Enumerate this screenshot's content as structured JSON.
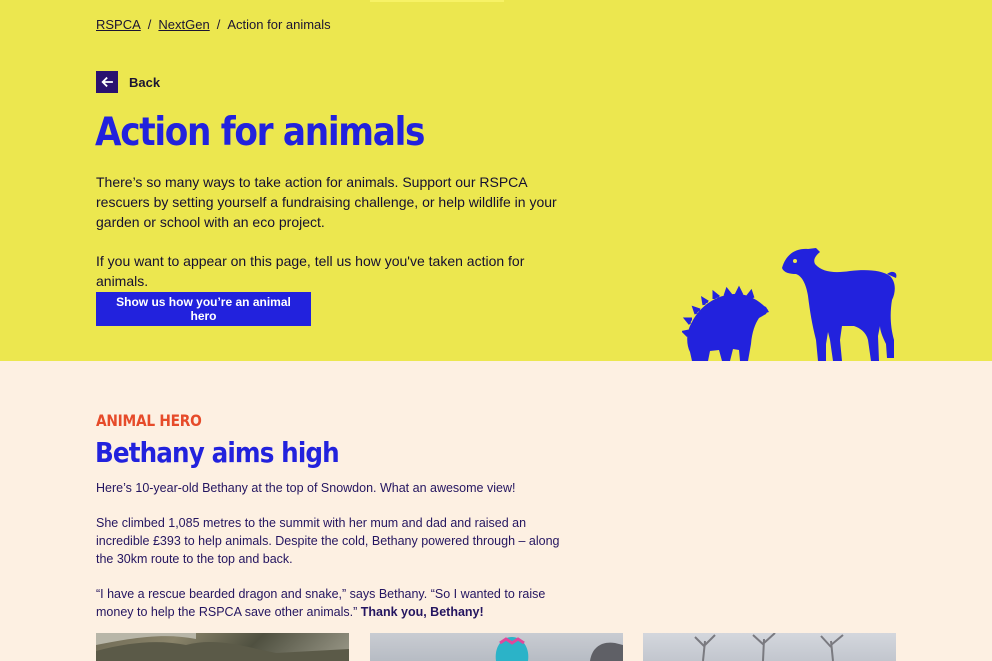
{
  "breadcrumb": {
    "items": [
      "RSPCA",
      "NextGen",
      "Action for animals"
    ],
    "separator": "/"
  },
  "back": {
    "label": "Back",
    "icon": "arrow-left-icon"
  },
  "hero": {
    "title": "Action for animals",
    "paragraph1": "There’s so many ways to take action for animals. Support our RSPCA rescuers by setting yourself a fundraising challenge, or help wildlife in your garden or school with an eco project.",
    "paragraph2": "If you want to appear on this page, tell us how you've taken action for animals.",
    "cta_label": "Show us how you’re an animal hero",
    "illustration": [
      "hedgehog-icon",
      "sheep-icon"
    ]
  },
  "story": {
    "label": "ANIMAL HERO",
    "title": "Bethany aims high",
    "paragraph1": "Here’s 10-year-old Bethany at the top of Snowdon. What an awesome view!",
    "paragraph2": "She climbed 1,085 metres to the summit with her mum and dad and raised an incredible £393 to help animals. Despite the cold, Bethany powered through – along the 30km route to the top and back.",
    "paragraph3_plain": "“I have a rescue bearded dragon and snake,” says Bethany. “So I wanted to raise money to help the RSPCA save other animals.”",
    "paragraph3_bold": "Thank you, Bethany!"
  },
  "colors": {
    "hero_bg": "#ece74f",
    "body_bg": "#fdf0e2",
    "accent_blue": "#2222dd",
    "label_orange": "#e64b2a",
    "back_box": "#2a1170"
  }
}
